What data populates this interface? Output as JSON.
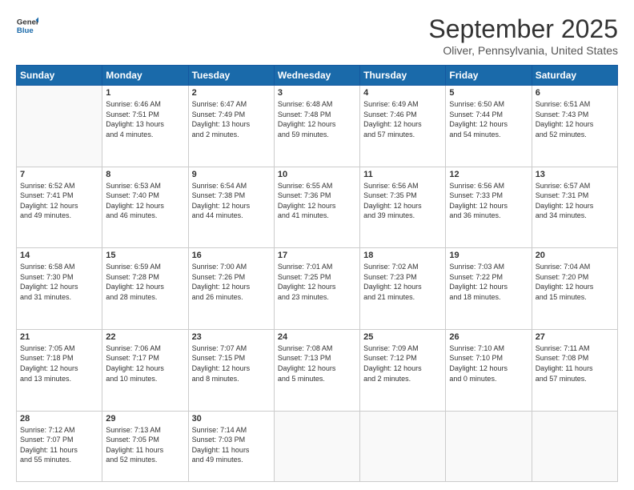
{
  "header": {
    "logo_line1": "General",
    "logo_line2": "Blue",
    "month": "September 2025",
    "location": "Oliver, Pennsylvania, United States"
  },
  "weekdays": [
    "Sunday",
    "Monday",
    "Tuesday",
    "Wednesday",
    "Thursday",
    "Friday",
    "Saturday"
  ],
  "weeks": [
    [
      {
        "day": "",
        "lines": []
      },
      {
        "day": "1",
        "lines": [
          "Sunrise: 6:46 AM",
          "Sunset: 7:51 PM",
          "Daylight: 13 hours",
          "and 4 minutes."
        ]
      },
      {
        "day": "2",
        "lines": [
          "Sunrise: 6:47 AM",
          "Sunset: 7:49 PM",
          "Daylight: 13 hours",
          "and 2 minutes."
        ]
      },
      {
        "day": "3",
        "lines": [
          "Sunrise: 6:48 AM",
          "Sunset: 7:48 PM",
          "Daylight: 12 hours",
          "and 59 minutes."
        ]
      },
      {
        "day": "4",
        "lines": [
          "Sunrise: 6:49 AM",
          "Sunset: 7:46 PM",
          "Daylight: 12 hours",
          "and 57 minutes."
        ]
      },
      {
        "day": "5",
        "lines": [
          "Sunrise: 6:50 AM",
          "Sunset: 7:44 PM",
          "Daylight: 12 hours",
          "and 54 minutes."
        ]
      },
      {
        "day": "6",
        "lines": [
          "Sunrise: 6:51 AM",
          "Sunset: 7:43 PM",
          "Daylight: 12 hours",
          "and 52 minutes."
        ]
      }
    ],
    [
      {
        "day": "7",
        "lines": [
          "Sunrise: 6:52 AM",
          "Sunset: 7:41 PM",
          "Daylight: 12 hours",
          "and 49 minutes."
        ]
      },
      {
        "day": "8",
        "lines": [
          "Sunrise: 6:53 AM",
          "Sunset: 7:40 PM",
          "Daylight: 12 hours",
          "and 46 minutes."
        ]
      },
      {
        "day": "9",
        "lines": [
          "Sunrise: 6:54 AM",
          "Sunset: 7:38 PM",
          "Daylight: 12 hours",
          "and 44 minutes."
        ]
      },
      {
        "day": "10",
        "lines": [
          "Sunrise: 6:55 AM",
          "Sunset: 7:36 PM",
          "Daylight: 12 hours",
          "and 41 minutes."
        ]
      },
      {
        "day": "11",
        "lines": [
          "Sunrise: 6:56 AM",
          "Sunset: 7:35 PM",
          "Daylight: 12 hours",
          "and 39 minutes."
        ]
      },
      {
        "day": "12",
        "lines": [
          "Sunrise: 6:56 AM",
          "Sunset: 7:33 PM",
          "Daylight: 12 hours",
          "and 36 minutes."
        ]
      },
      {
        "day": "13",
        "lines": [
          "Sunrise: 6:57 AM",
          "Sunset: 7:31 PM",
          "Daylight: 12 hours",
          "and 34 minutes."
        ]
      }
    ],
    [
      {
        "day": "14",
        "lines": [
          "Sunrise: 6:58 AM",
          "Sunset: 7:30 PM",
          "Daylight: 12 hours",
          "and 31 minutes."
        ]
      },
      {
        "day": "15",
        "lines": [
          "Sunrise: 6:59 AM",
          "Sunset: 7:28 PM",
          "Daylight: 12 hours",
          "and 28 minutes."
        ]
      },
      {
        "day": "16",
        "lines": [
          "Sunrise: 7:00 AM",
          "Sunset: 7:26 PM",
          "Daylight: 12 hours",
          "and 26 minutes."
        ]
      },
      {
        "day": "17",
        "lines": [
          "Sunrise: 7:01 AM",
          "Sunset: 7:25 PM",
          "Daylight: 12 hours",
          "and 23 minutes."
        ]
      },
      {
        "day": "18",
        "lines": [
          "Sunrise: 7:02 AM",
          "Sunset: 7:23 PM",
          "Daylight: 12 hours",
          "and 21 minutes."
        ]
      },
      {
        "day": "19",
        "lines": [
          "Sunrise: 7:03 AM",
          "Sunset: 7:22 PM",
          "Daylight: 12 hours",
          "and 18 minutes."
        ]
      },
      {
        "day": "20",
        "lines": [
          "Sunrise: 7:04 AM",
          "Sunset: 7:20 PM",
          "Daylight: 12 hours",
          "and 15 minutes."
        ]
      }
    ],
    [
      {
        "day": "21",
        "lines": [
          "Sunrise: 7:05 AM",
          "Sunset: 7:18 PM",
          "Daylight: 12 hours",
          "and 13 minutes."
        ]
      },
      {
        "day": "22",
        "lines": [
          "Sunrise: 7:06 AM",
          "Sunset: 7:17 PM",
          "Daylight: 12 hours",
          "and 10 minutes."
        ]
      },
      {
        "day": "23",
        "lines": [
          "Sunrise: 7:07 AM",
          "Sunset: 7:15 PM",
          "Daylight: 12 hours",
          "and 8 minutes."
        ]
      },
      {
        "day": "24",
        "lines": [
          "Sunrise: 7:08 AM",
          "Sunset: 7:13 PM",
          "Daylight: 12 hours",
          "and 5 minutes."
        ]
      },
      {
        "day": "25",
        "lines": [
          "Sunrise: 7:09 AM",
          "Sunset: 7:12 PM",
          "Daylight: 12 hours",
          "and 2 minutes."
        ]
      },
      {
        "day": "26",
        "lines": [
          "Sunrise: 7:10 AM",
          "Sunset: 7:10 PM",
          "Daylight: 12 hours",
          "and 0 minutes."
        ]
      },
      {
        "day": "27",
        "lines": [
          "Sunrise: 7:11 AM",
          "Sunset: 7:08 PM",
          "Daylight: 11 hours",
          "and 57 minutes."
        ]
      }
    ],
    [
      {
        "day": "28",
        "lines": [
          "Sunrise: 7:12 AM",
          "Sunset: 7:07 PM",
          "Daylight: 11 hours",
          "and 55 minutes."
        ]
      },
      {
        "day": "29",
        "lines": [
          "Sunrise: 7:13 AM",
          "Sunset: 7:05 PM",
          "Daylight: 11 hours",
          "and 52 minutes."
        ]
      },
      {
        "day": "30",
        "lines": [
          "Sunrise: 7:14 AM",
          "Sunset: 7:03 PM",
          "Daylight: 11 hours",
          "and 49 minutes."
        ]
      },
      {
        "day": "",
        "lines": []
      },
      {
        "day": "",
        "lines": []
      },
      {
        "day": "",
        "lines": []
      },
      {
        "day": "",
        "lines": []
      }
    ]
  ]
}
